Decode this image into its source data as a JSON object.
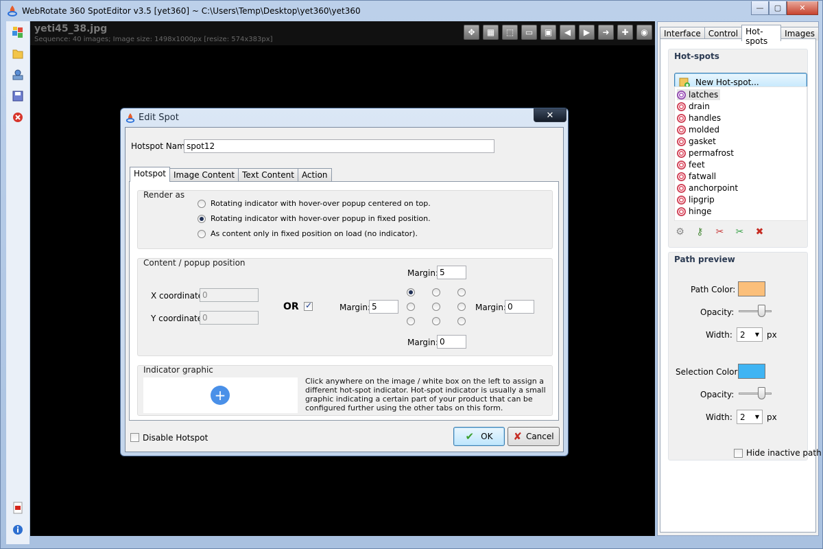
{
  "app": {
    "title": "WebRotate 360 SpotEditor v3.5 [yet360] ~ C:\\Users\\Temp\\Desktop\\yet360\\yet360",
    "window_buttons": {
      "minimize": "—",
      "maximize": "▢",
      "close": "✕"
    }
  },
  "left_toolbar": {
    "icons": [
      "cubes-icon",
      "folder-icon",
      "publish-icon",
      "save-icon",
      "close-red-icon",
      "pdf-icon",
      "info-icon"
    ]
  },
  "viewer": {
    "filename": "yeti45_38.jpg",
    "sequence_info": "Sequence: 40 images; Image size: 1498x1000px [resize: 574x383px]",
    "tools": [
      {
        "name": "move-icon",
        "glyph": "✥"
      },
      {
        "name": "grid-icon",
        "glyph": "▦"
      },
      {
        "name": "select-region-icon",
        "glyph": "⬚"
      },
      {
        "name": "fit-icon",
        "glyph": "▭"
      },
      {
        "name": "fullscreen-icon",
        "glyph": "▣"
      },
      {
        "name": "arrow-left-icon",
        "glyph": "◀"
      },
      {
        "name": "play-icon",
        "glyph": "▶"
      },
      {
        "name": "arrow-right-icon",
        "glyph": "➜"
      },
      {
        "name": "zoom-plus-icon",
        "glyph": "✚"
      },
      {
        "name": "reset-icon",
        "glyph": "◉"
      }
    ]
  },
  "right_panel": {
    "tabs": [
      {
        "label": "Interface",
        "active": false
      },
      {
        "label": "Control",
        "active": false
      },
      {
        "label": "Hot-spots",
        "active": true
      },
      {
        "label": "Images",
        "active": false
      }
    ],
    "hotspots": {
      "title": "Hot-spots",
      "new_button": "New Hot-spot...",
      "items": [
        {
          "label": "latches",
          "selected": true
        },
        {
          "label": "drain",
          "selected": false
        },
        {
          "label": "handles",
          "selected": false
        },
        {
          "label": "molded",
          "selected": false
        },
        {
          "label": "gasket",
          "selected": false
        },
        {
          "label": "permafrost",
          "selected": false
        },
        {
          "label": "feet",
          "selected": false
        },
        {
          "label": "fatwall",
          "selected": false
        },
        {
          "label": "anchorpoint",
          "selected": false
        },
        {
          "label": "lipgrip",
          "selected": false
        },
        {
          "label": "hinge",
          "selected": false
        }
      ],
      "tools": [
        "settings-icon",
        "key-icon",
        "cut-icon",
        "add-spot-icon",
        "delete-icon"
      ]
    },
    "path_preview": {
      "title": "Path preview",
      "path_color_label": "Path Color:",
      "path_color": "#fbbf7a",
      "opacity_label": "Opacity:",
      "path_opacity": 0.75,
      "width_label": "Width:",
      "path_width": "2",
      "px_label": "px",
      "selection_color_label": "Selection Color:",
      "selection_color": "#3fb4f3",
      "selection_opacity": 0.75,
      "selection_width": "2",
      "hide_inactive_label": "Hide inactive path",
      "hide_inactive_checked": false
    }
  },
  "dialog": {
    "title": "Edit Spot",
    "close_glyph": "✕",
    "name_label": "Hotspot Name:",
    "name_value": "spot12",
    "tabs": [
      {
        "label": "Hotspot",
        "active": true
      },
      {
        "label": "Image Content",
        "active": false
      },
      {
        "label": "Text Content",
        "active": false
      },
      {
        "label": "Action",
        "active": false
      }
    ],
    "render_as": {
      "title": "Render as",
      "options": [
        {
          "label": "Rotating indicator with hover-over popup centered on top.",
          "checked": false
        },
        {
          "label": "Rotating indicator with hover-over popup in fixed position.",
          "checked": true
        },
        {
          "label": "As content only in fixed position on load (no indicator).",
          "checked": false
        }
      ]
    },
    "position": {
      "title": "Content / popup position",
      "x_label": "X coordinate:",
      "x_value": "0",
      "y_label": "Y coordinate:",
      "y_value": "0",
      "or_label": "OR",
      "or_checked": true,
      "margin_label": "Margin:",
      "margin_top": "5",
      "margin_left": "5",
      "margin_right": "0",
      "margin_bottom": "0",
      "anchor_selected": "top-left"
    },
    "indicator": {
      "title": "Indicator graphic",
      "description": "Click anywhere on the image / white box on the left to assign a different hot-spot indicator. Hot-spot indicator is usually a small graphic indicating a certain part of your product that can be configured further using the other tabs on this form.",
      "plus_glyph": "+"
    },
    "disable_label": "Disable Hotspot",
    "disable_checked": false,
    "ok_label": "OK",
    "cancel_label": "Cancel"
  }
}
